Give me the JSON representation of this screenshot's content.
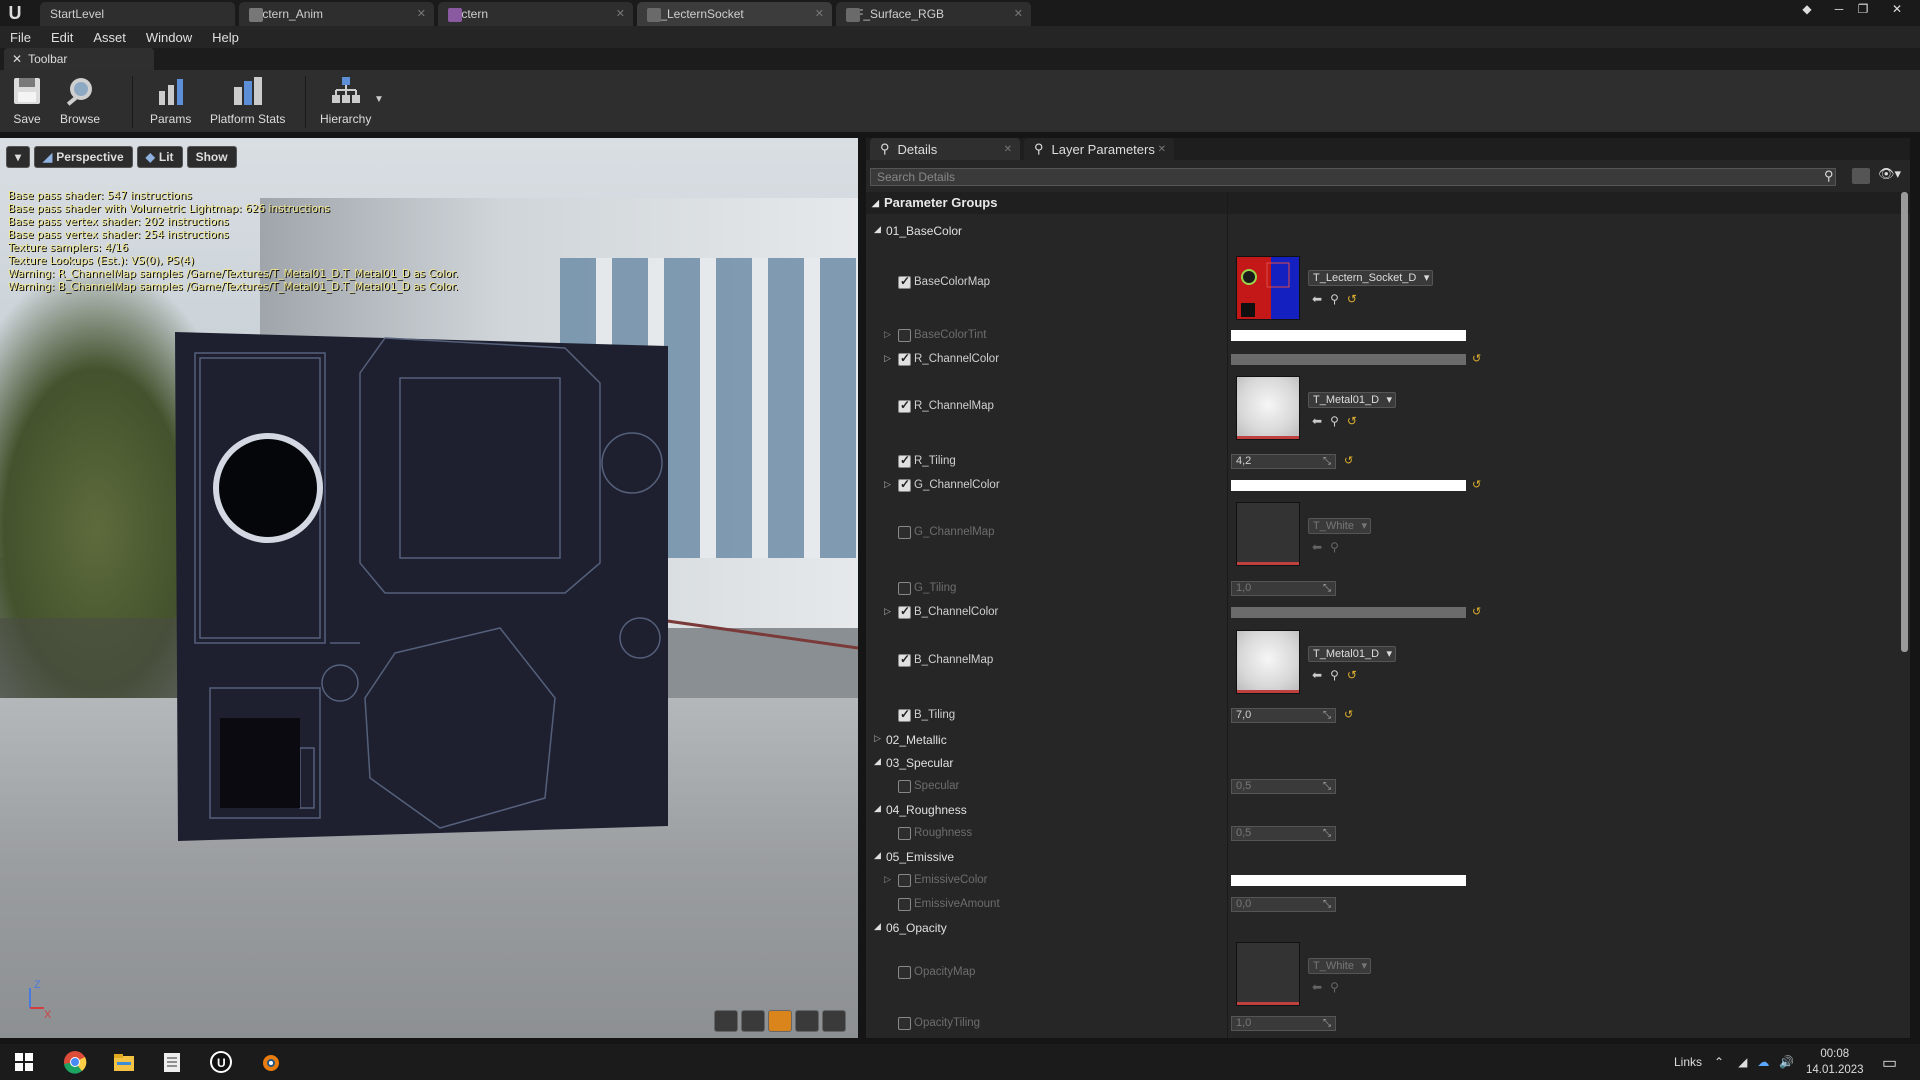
{
  "tabs": [
    {
      "label": "StartLevel"
    },
    {
      "label": "Lectern_Anim"
    },
    {
      "label": "Lectern"
    },
    {
      "label": "MI_LecternSocket"
    },
    {
      "label": "MF_Surface_RGB"
    }
  ],
  "menu": [
    "File",
    "Edit",
    "Asset",
    "Window",
    "Help"
  ],
  "toolbar": {
    "tab_label": "Toolbar",
    "save": "Save",
    "browse": "Browse",
    "params": "Params",
    "platform_stats": "Platform Stats",
    "hierarchy": "Hierarchy"
  },
  "viewport": {
    "perspective": "Perspective",
    "lit": "Lit",
    "show": "Show",
    "stats": [
      "Base pass shader: 547 instructions",
      "Base pass shader with Volumetric Lightmap: 626 instructions",
      "Base pass vertex shader: 202 instructions",
      "Base pass vertex shader: 254 instructions",
      "Texture samplers: 4/16",
      "Texture Lookups (Est.): VS(0), PS(4)",
      "Warning: R_ChannelMap samples /Game/Textures/T_Metal01_D.T_Metal01_D as Color.",
      "Warning: B_ChannelMap samples /Game/Textures/T_Metal01_D.T_Metal01_D as Color."
    ],
    "axis_z": "Z",
    "axis_x": "X"
  },
  "details": {
    "tab_details": "Details",
    "tab_layer": "Layer Parameters",
    "search_placeholder": "Search Details",
    "param_groups": "Parameter Groups",
    "g01": "01_BaseColor",
    "basecolormap": "BaseColorMap",
    "basecolormap_asset": "T_Lectern_Socket_D",
    "basecolortint": "BaseColorTint",
    "r_channelcolor": "R_ChannelColor",
    "r_channelmap": "R_ChannelMap",
    "r_channelmap_asset": "T_Metal01_D",
    "r_tiling": "R_Tiling",
    "r_tiling_value": "4,2",
    "g_channelcolor": "G_ChannelColor",
    "g_channelmap": "G_ChannelMap",
    "g_channelmap_asset": "T_White",
    "g_tiling": "G_Tiling",
    "g_tiling_value": "1,0",
    "b_channelcolor": "B_ChannelColor",
    "b_channelmap": "B_ChannelMap",
    "b_channelmap_asset": "T_Metal01_D",
    "b_tiling": "B_Tiling",
    "b_tiling_value": "7,0",
    "g02": "02_Metallic",
    "g03": "03_Specular",
    "specular": "Specular",
    "specular_value": "0,5",
    "g04": "04_Roughness",
    "roughness": "Roughness",
    "roughness_value": "0,5",
    "g05": "05_Emissive",
    "emissivecolor": "EmissiveColor",
    "emissiveamount": "EmissiveAmount",
    "emissiveamount_value": "0,0",
    "g06": "06_Opacity",
    "opacitymap": "OpacityMap",
    "opacitymap_asset": "T_White",
    "opacitytiling": "OpacityTiling",
    "opacitytiling_value": "1,0"
  },
  "taskbar": {
    "links": "Links",
    "time": "00:08",
    "date": "14.01.2023"
  }
}
